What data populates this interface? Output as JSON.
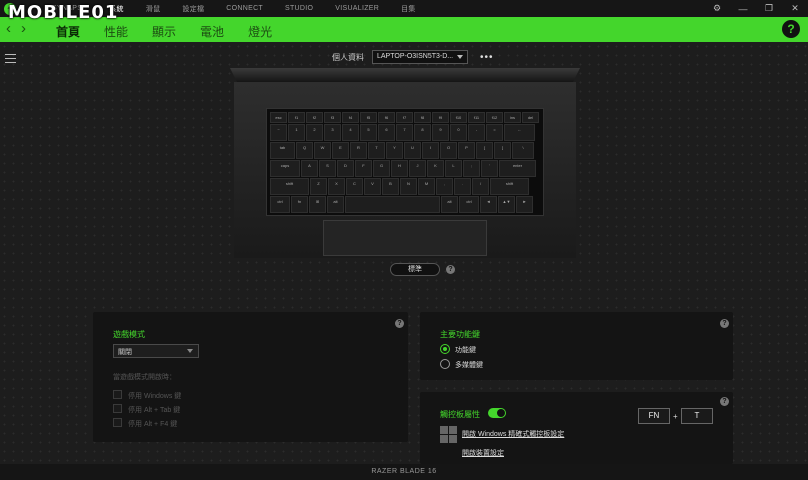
{
  "watermark": "MOBILE01",
  "topnav": {
    "items": [
      "SYNAPSE",
      "系統",
      "滑鼠",
      "設定檔",
      "CONNECT",
      "STUDIO",
      "VISUALIZER",
      "目集"
    ],
    "active_index": 1
  },
  "window_controls": {
    "settings": "⚙",
    "minimize": "—",
    "restore": "❐",
    "close": "✕"
  },
  "green_tabs": {
    "items": [
      "首頁",
      "性能",
      "顯示",
      "電池",
      "燈光"
    ],
    "active_index": 0,
    "help": "?"
  },
  "profile": {
    "label": "個人資料",
    "value": "LAPTOP-O3ISN5T3-D...",
    "more": "•••"
  },
  "standard_button": "標準",
  "keyboard": {
    "rows": [
      [
        "esc",
        "f1",
        "f2",
        "f3",
        "f4",
        "f5",
        "f6",
        "f7",
        "f8",
        "f9",
        "f10",
        "f11",
        "f12",
        "ins",
        "del"
      ],
      [
        "~",
        "1",
        "2",
        "3",
        "4",
        "5",
        "6",
        "7",
        "8",
        "9",
        "0",
        "-",
        "=",
        "←"
      ],
      [
        "tab",
        "Q",
        "W",
        "E",
        "R",
        "T",
        "Y",
        "U",
        "I",
        "O",
        "P",
        "[",
        "]",
        "\\"
      ],
      [
        "caps",
        "A",
        "S",
        "D",
        "F",
        "G",
        "H",
        "J",
        "K",
        "L",
        ";",
        "'",
        "enter"
      ],
      [
        "shift",
        "Z",
        "X",
        "C",
        "V",
        "B",
        "N",
        "M",
        ",",
        ".",
        "/",
        "shift"
      ],
      [
        "ctrl",
        "fn",
        "⊞",
        "alt",
        "",
        "alt",
        "ctrl",
        "◄",
        "▲▼",
        "►"
      ]
    ]
  },
  "game_mode_panel": {
    "title": "遊戲模式",
    "dropdown_value": "關閉",
    "hint": "當遊戲模式開啟時：",
    "options": [
      "停用 Windows 鍵",
      "停用 Alt + Tab 鍵",
      "停用 Alt + F4 鍵"
    ]
  },
  "primary_fn_panel": {
    "title": "主要功能鍵",
    "options": [
      "功能鍵",
      "多媒體鍵"
    ],
    "selected_index": 0
  },
  "touchpad_panel": {
    "title": "觸控板屬性",
    "toggle_on": true,
    "link1": "開啟 Windows 精確式觸控板設定",
    "link2": "開啟裝置設定",
    "shortcut_key1": "FN",
    "shortcut_plus": "+",
    "shortcut_key2": "T"
  },
  "device_name": "RAZER BLADE 16",
  "colors": {
    "accent": "#44d62c"
  }
}
